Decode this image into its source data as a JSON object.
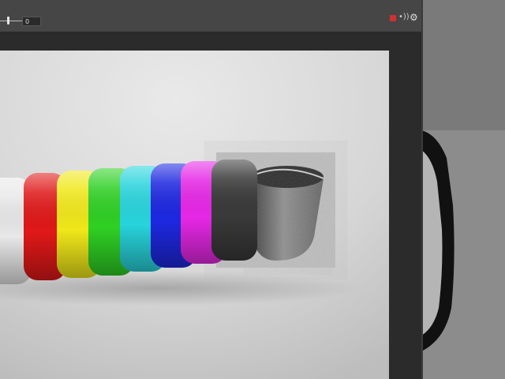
{
  "toolbar": {
    "frame_value": "0"
  },
  "icons": {
    "record": "record-icon",
    "audio": "audio-icon",
    "settings": "gear-icon"
  },
  "colors": {
    "record_red": "#d03030",
    "toolbar_bg": "#464646",
    "viewport_bg": "#2b2b2b"
  }
}
